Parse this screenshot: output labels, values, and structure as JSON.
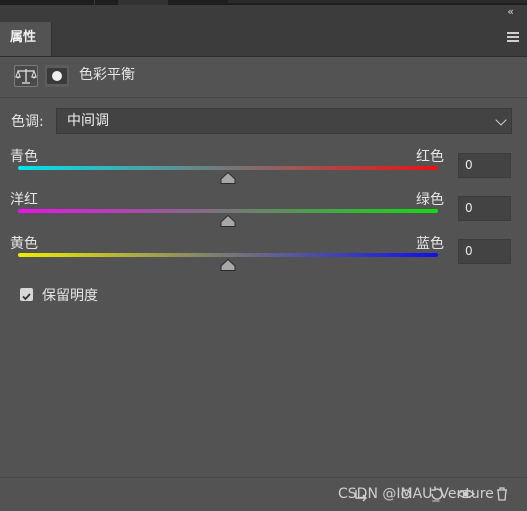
{
  "panel": {
    "collapse_icon": "«",
    "tab_label": "属性",
    "menu_icon": "panel-menu-icon"
  },
  "header": {
    "adjustment_icon": "balance-scale-icon",
    "mask_icon": "mask-icon",
    "title": "色彩平衡"
  },
  "tone": {
    "label": "色调:",
    "value": "中间调"
  },
  "sliders": [
    {
      "left_label": "青色",
      "right_label": "红色",
      "value": "0",
      "position": 0.5,
      "from_color": "#00e5ee",
      "to_color": "#ee1010"
    },
    {
      "left_label": "洋红",
      "right_label": "绿色",
      "value": "0",
      "position": 0.5,
      "from_color": "#ee10ee",
      "to_color": "#10dd10"
    },
    {
      "left_label": "黄色",
      "right_label": "蓝色",
      "value": "0",
      "position": 0.5,
      "from_color": "#eeee00",
      "to_color": "#1010ee"
    }
  ],
  "preserve": {
    "label": "保留明度",
    "checked": true
  },
  "footer": {
    "watermark": "CSDN @IMAU_Venture",
    "icons": [
      "clip-to-layer-icon",
      "view-previous-icon",
      "reset-icon",
      "visibility-icon",
      "trash-icon"
    ]
  }
}
